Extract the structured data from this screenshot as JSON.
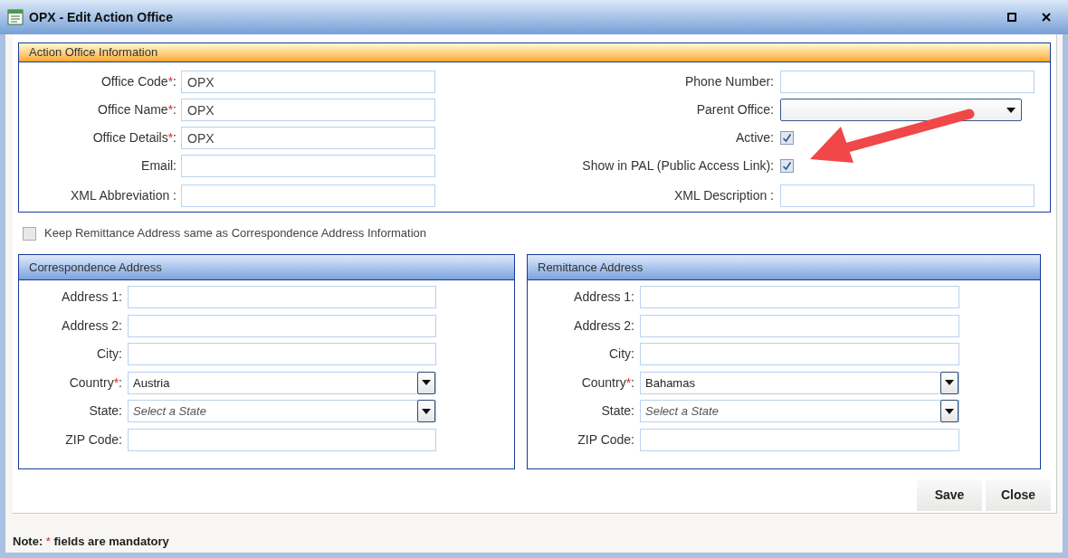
{
  "window": {
    "title": "OPX - Edit Action Office"
  },
  "required_mark": "*",
  "office_section": {
    "title": "Action Office Information",
    "left": [
      {
        "kind": "text",
        "label": "Office Code",
        "required": true,
        "punct": ":",
        "value": "OPX"
      },
      {
        "kind": "text",
        "label": "Office Name",
        "required": true,
        "punct": ":",
        "value": "OPX"
      },
      {
        "kind": "text",
        "label": "Office Details",
        "required": true,
        "punct": ":",
        "value": "OPX"
      },
      {
        "kind": "text",
        "label": "Email",
        "required": false,
        "punct": ":"
      },
      {
        "kind": "text",
        "label": "XML Abbreviation",
        "required": false,
        "punct": " :"
      }
    ],
    "right": [
      {
        "kind": "text",
        "label": "Phone Number",
        "required": false,
        "punct": ":"
      },
      {
        "kind": "select",
        "label": "Parent Office",
        "required": false,
        "punct": ":"
      },
      {
        "kind": "checkbox",
        "label": "Active",
        "required": false,
        "punct": ":",
        "checked": true
      },
      {
        "kind": "checkbox",
        "label": "Show in PAL (Public Access Link)",
        "required": false,
        "punct": ":",
        "checked": true
      },
      {
        "kind": "text",
        "label": "XML Description",
        "required": false,
        "punct": " :"
      }
    ]
  },
  "same_address": {
    "label": "Keep Remittance Address same as Correspondence Address Information",
    "checked": false
  },
  "address_sections": [
    {
      "title": "Correspondence Address",
      "fields": [
        {
          "kind": "text",
          "label": "Address 1",
          "required": false,
          "punct": ":"
        },
        {
          "kind": "text",
          "label": "Address 2",
          "required": false,
          "punct": ":"
        },
        {
          "kind": "text",
          "label": "City",
          "required": false,
          "punct": ":"
        },
        {
          "kind": "combo",
          "label": "Country",
          "required": true,
          "punct": ":",
          "value": "Austria"
        },
        {
          "kind": "combo",
          "label": "State",
          "required": false,
          "punct": ":",
          "placeholder": "Select a State"
        },
        {
          "kind": "text",
          "label": "ZIP Code",
          "required": false,
          "punct": ":"
        }
      ]
    },
    {
      "title": "Remittance Address",
      "fields": [
        {
          "kind": "text",
          "label": "Address 1",
          "required": false,
          "punct": ":"
        },
        {
          "kind": "text",
          "label": "Address 2",
          "required": false,
          "punct": ":"
        },
        {
          "kind": "text",
          "label": "City",
          "required": false,
          "punct": ":"
        },
        {
          "kind": "combo",
          "label": "Country",
          "required": true,
          "punct": ":",
          "value": "Bahamas"
        },
        {
          "kind": "combo",
          "label": "State",
          "required": false,
          "punct": ":",
          "placeholder": "Select a State"
        },
        {
          "kind": "text",
          "label": "ZIP Code",
          "required": false,
          "punct": ":"
        }
      ]
    }
  ],
  "buttons": [
    "Save",
    "Close"
  ],
  "note": {
    "prefix": "Note:",
    "mark": "*",
    "text": "fields are mandatory"
  }
}
